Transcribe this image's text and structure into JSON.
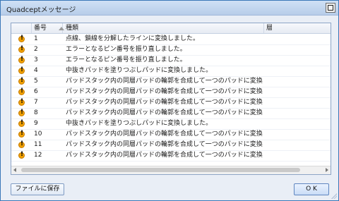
{
  "window": {
    "title": "Quadceptメッセージ"
  },
  "table": {
    "columns": {
      "icon": "",
      "number": "番号",
      "type": "種類",
      "layer": "層"
    },
    "rows": [
      {
        "num": "1",
        "text": "点線、鎖線を分解したラインに変換しました。"
      },
      {
        "num": "2",
        "text": "エラーとなるピン番号を振り直しました。"
      },
      {
        "num": "3",
        "text": "エラーとなるピン番号を振り直しました。"
      },
      {
        "num": "4",
        "text": "中抜きパッドを塗りつぶしパッドに変換しました。"
      },
      {
        "num": "5",
        "text": "パッドスタック内の同層パッドの輪郭を合成して一つのパッドに変換しました。"
      },
      {
        "num": "6",
        "text": "パッドスタック内の同層パッドの輪郭を合成して一つのパッドに変換しました。"
      },
      {
        "num": "7",
        "text": "パッドスタック内の同層パッドの輪郭を合成して一つのパッドに変換しました。"
      },
      {
        "num": "8",
        "text": "パッドスタック内の同層パッドの輪郭を合成して一つのパッドに変換しました。"
      },
      {
        "num": "9",
        "text": "中抜きパッドを塗りつぶしパッドに変換しました。"
      },
      {
        "num": "10",
        "text": "パッドスタック内の同層パッドの輪郭を合成して一つのパッドに変換しました。"
      },
      {
        "num": "11",
        "text": "パッドスタック内の同層パッドの輪郭を合成して一つのパッドに変換しました。"
      },
      {
        "num": "12",
        "text": "パッドスタック内の同層パッドの輪郭を合成して一つのパッドに変換しました。"
      }
    ]
  },
  "buttons": {
    "save": "ファイルに保存",
    "ok": "O K"
  },
  "colors": {
    "title_bar": "#b7cde9",
    "border": "#3b78b8",
    "warning": "#f0a000"
  },
  "icons": {
    "row": "warning-icon",
    "close": "close-icon",
    "sort": "sort-ascending-icon"
  }
}
